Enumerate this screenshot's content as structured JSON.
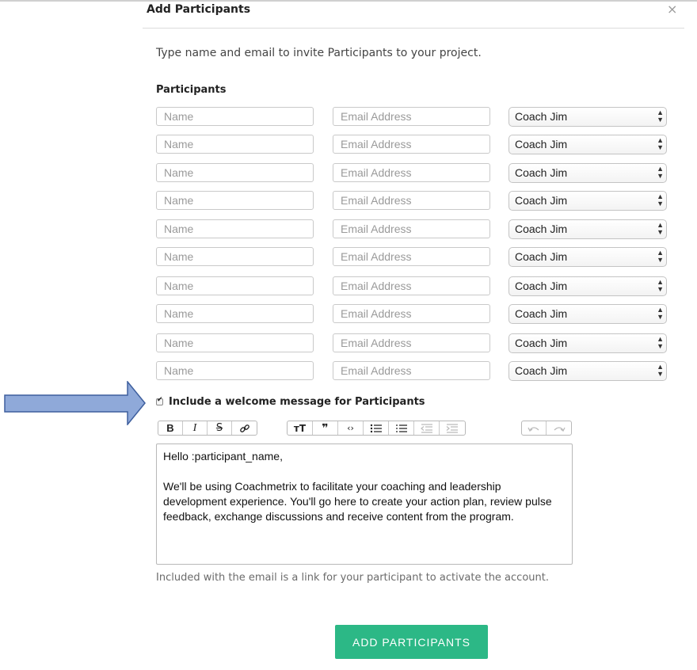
{
  "dialog": {
    "title": "Add Participants",
    "close_glyph": "×",
    "intro": "Type name and email to invite Participants to your project.",
    "section_label": "Participants"
  },
  "participants": {
    "name_placeholder": "Name",
    "email_placeholder": "Email Address",
    "rows": [
      {
        "coach": "Coach Jim"
      },
      {
        "coach": "Coach Jim"
      },
      {
        "coach": "Coach Jim"
      },
      {
        "coach": "Coach Jim"
      },
      {
        "coach": "Coach Jim"
      },
      {
        "coach": "Coach Jim"
      },
      {
        "coach": "Coach Jim"
      },
      {
        "coach": "Coach Jim"
      },
      {
        "coach": "Coach Jim"
      },
      {
        "coach": "Coach Jim"
      }
    ]
  },
  "welcome": {
    "checked": true,
    "label": "Include a welcome message for Participants",
    "toolbar": {
      "group1": [
        "bold-icon",
        "italic-icon",
        "strikethrough-icon",
        "link-icon"
      ],
      "group2": [
        "text-size-icon",
        "quote-icon",
        "code-icon",
        "bullet-list-icon",
        "numbered-list-icon",
        "outdent-icon",
        "indent-icon"
      ],
      "group3": [
        "undo-icon",
        "redo-icon"
      ]
    },
    "message_line1": "Hello :participant_name,",
    "message_line2": "We'll be using Coachmetrix to facilitate your coaching and leadership development experience. You'll go here to create your action plan, review pulse feedback, exchange discussions and receive content from the program."
  },
  "helper_text": "Included with the email is a link for your participant to activate the account.",
  "submit_label": "ADD PARTICIPANTS",
  "colors": {
    "accent": "#2cb886",
    "annotation_arrow": "#8fa9d9"
  }
}
